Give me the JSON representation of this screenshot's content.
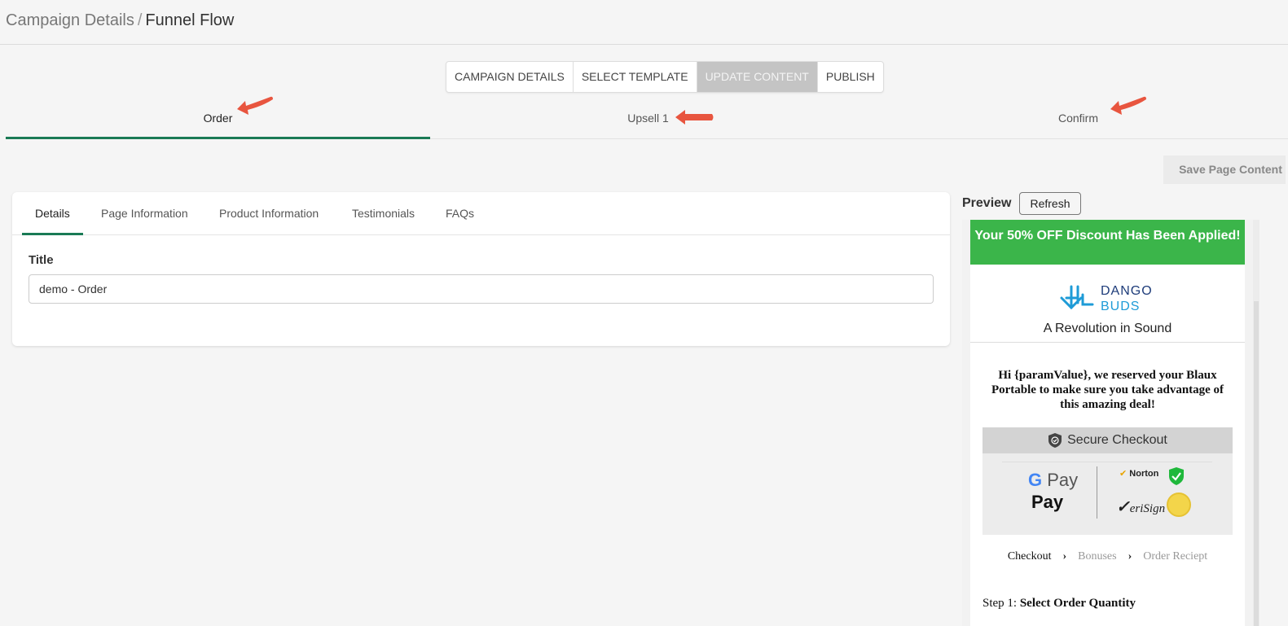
{
  "breadcrumb": {
    "parent": "Campaign Details",
    "separator": "/",
    "current": "Funnel Flow"
  },
  "stepper": [
    {
      "label": "CAMPAIGN DETAILS",
      "active": false
    },
    {
      "label": "SELECT TEMPLATE",
      "active": false
    },
    {
      "label": "UPDATE CONTENT",
      "active": true
    },
    {
      "label": "PUBLISH",
      "active": false
    }
  ],
  "page_tabs": [
    {
      "label": "Order",
      "active": true
    },
    {
      "label": "Upsell 1",
      "active": false
    },
    {
      "label": "Confirm",
      "active": false
    }
  ],
  "save_button": "Save Page Content",
  "card": {
    "tabs": [
      {
        "label": "Details",
        "active": true
      },
      {
        "label": "Page Information",
        "active": false
      },
      {
        "label": "Product Information",
        "active": false
      },
      {
        "label": "Testimonials",
        "active": false
      },
      {
        "label": "FAQs",
        "active": false
      }
    ],
    "title_label": "Title",
    "title_value": "demo - Order"
  },
  "preview": {
    "label": "Preview",
    "refresh": "Refresh",
    "banner": "Your 50% OFF Discount Has Been Applied!",
    "logo_top": "DANGO",
    "logo_bottom": "BUDS",
    "tagline": "A Revolution in Sound",
    "message": "Hi {paramValue}, we reserved your Blaux Portable to make sure you take advantage of this amazing deal!",
    "secure_checkout": "Secure Checkout",
    "gpay": "Pay",
    "apay": "Pay",
    "norton": "Norton",
    "verisign": "eriSign",
    "progress": {
      "step1": "Checkout",
      "step2": "Bonuses",
      "step3": "Order Reciept"
    },
    "step_prefix": "Step 1:",
    "step_title": "Select Order Quantity"
  },
  "colors": {
    "accent": "#1a7a55",
    "banner_green": "#3bb54a",
    "arrow_red": "#e8553f",
    "logo_blue": "#1e9bd7"
  }
}
